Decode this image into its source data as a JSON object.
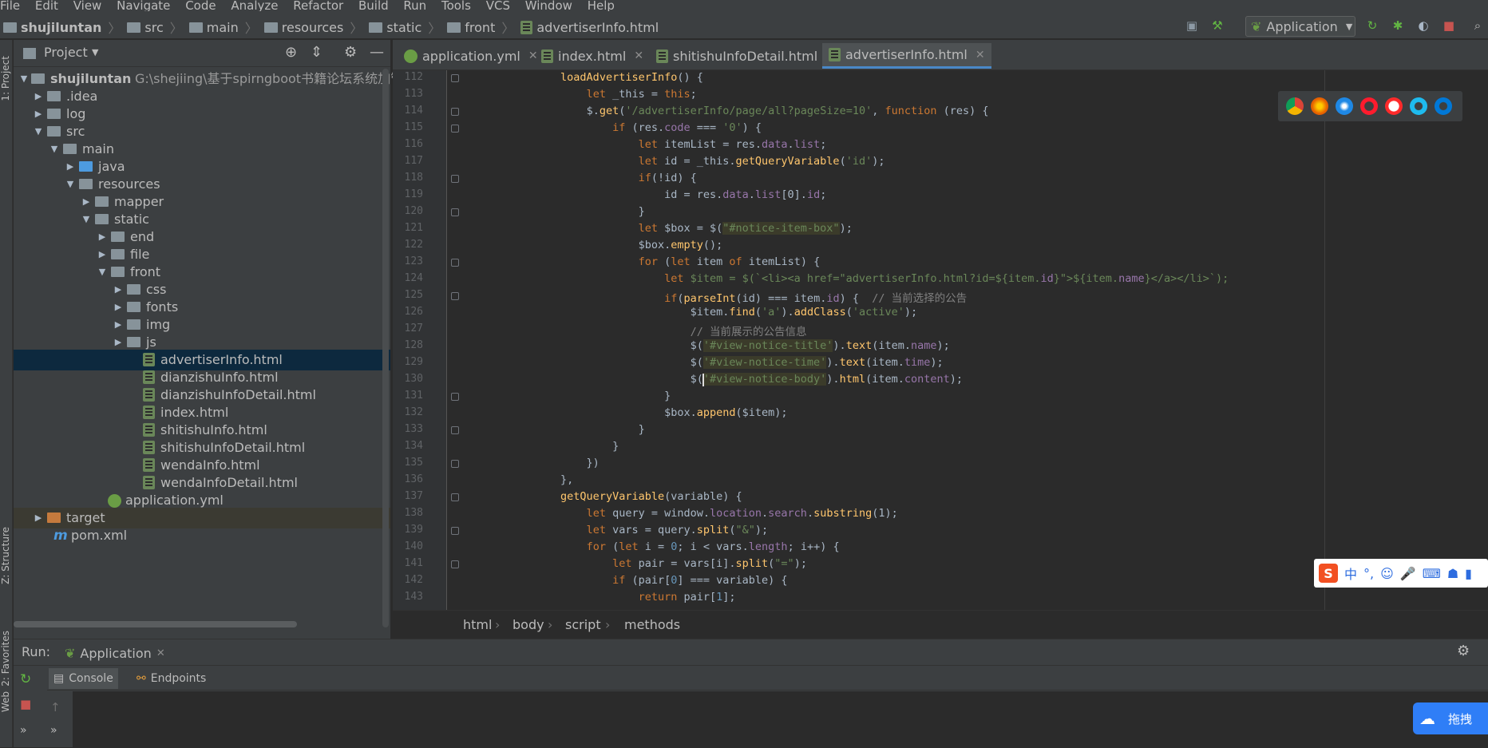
{
  "menu": [
    "File",
    "Edit",
    "View",
    "Navigate",
    "Code",
    "Analyze",
    "Refactor",
    "Build",
    "Run",
    "Tools",
    "VCS",
    "Window",
    "Help"
  ],
  "breadcrumb": [
    "shujiluntan",
    "src",
    "main",
    "resources",
    "static",
    "front",
    "advertiserInfo.html"
  ],
  "toolbar": {
    "run_config": "Application"
  },
  "side_tools": {
    "project": "1: Project",
    "structure": "Z: Structure",
    "favorites": "2: Favorites",
    "web": "Web"
  },
  "project": {
    "header": "Project",
    "root_name": "shujiluntan",
    "root_path": "G:\\shejiing\\基于spirngboot书籍论坛系统加管理",
    "items": [
      {
        "label": ".idea"
      },
      {
        "label": "log"
      },
      {
        "label": "src"
      },
      {
        "label": "main"
      },
      {
        "label": "java"
      },
      {
        "label": "resources"
      },
      {
        "label": "mapper"
      },
      {
        "label": "static"
      },
      {
        "label": "end"
      },
      {
        "label": "file"
      },
      {
        "label": "front"
      },
      {
        "label": "css"
      },
      {
        "label": "fonts"
      },
      {
        "label": "img"
      },
      {
        "label": "js"
      },
      {
        "label": "advertiserInfo.html"
      },
      {
        "label": "dianzishuInfo.html"
      },
      {
        "label": "dianzishuInfoDetail.html"
      },
      {
        "label": "index.html"
      },
      {
        "label": "shitishuInfo.html"
      },
      {
        "label": "shitishuInfoDetail.html"
      },
      {
        "label": "wendaInfo.html"
      },
      {
        "label": "wendaInfoDetail.html"
      },
      {
        "label": "application.yml"
      },
      {
        "label": "target"
      },
      {
        "label": "pom.xml"
      }
    ]
  },
  "tabs": [
    {
      "label": "application.yml"
    },
    {
      "label": "index.html"
    },
    {
      "label": "shitishuInfoDetail.html"
    },
    {
      "label": "advertiserInfo.html"
    }
  ],
  "line_numbers": [
    "112",
    "113",
    "114",
    "115",
    "116",
    "117",
    "118",
    "119",
    "120",
    "121",
    "122",
    "123",
    "124",
    "125",
    "126",
    "127",
    "128",
    "129",
    "130",
    "131",
    "132",
    "133",
    "134",
    "135",
    "136",
    "137",
    "138",
    "139",
    "140",
    "141",
    "142",
    "143"
  ],
  "code": {
    "l112": "loadAdvertiserInfo",
    "l113a": "let",
    "l113b": " _this = ",
    "l113c": "this",
    "l114a": "$.",
    "l114b": "get",
    "l114c": "'/advertiserInfo/page/all?pageSize=10'",
    "l114d": "function",
    "l114e": " (res) {",
    "l115a": "if",
    "l115b": " (res.",
    "l115c": "code",
    "l115d": " === ",
    "l115e": "'0'",
    "l116a": "let",
    "l116b": " itemList = res.",
    "l116c": "data",
    "l116d": "list",
    "l117a": "let",
    "l117b": " id = _this.",
    "l117c": "getQueryVariable",
    "l117d": "'id'",
    "l118a": "if",
    "l118b": "(!id) {",
    "l119a": "id = res.",
    "l119b": "data",
    "l119c": "list",
    "l119d": "[0].",
    "l119e": "id",
    "l121a": "let",
    "l121b": " $box = $(",
    "l121c": "\"#notice-item-box\"",
    "l122a": "$box.",
    "l122b": "empty",
    "l123a": "for",
    "l123b": " (",
    "l123c": "let",
    "l123d": " item ",
    "l123e": "of",
    "l123f": " itemList) {",
    "l124a": "let",
    "l124b": " $item = $(`<li><a href=\"advertiserInfo.html?id=${item.",
    "l124c": "id",
    "l124d": "}\">${item.",
    "l124e": "name",
    "l124f": "}</a></li>`);",
    "l125a": "if",
    "l125b": "(",
    "l125c": "parseInt",
    "l125d": "(id) === item.",
    "l125e": "id",
    "l125f": ") {  ",
    "l125g": "// 当前选择的公告",
    "l126a": "$item.",
    "l126b": "find",
    "l126c": "'a'",
    "l126d": "addClass",
    "l126e": "'active'",
    "l127": "// 当前展示的公告信息",
    "l128a": "'#view-notice-title'",
    "l128b": "text",
    "l128c": "name",
    "l129a": "'#view-notice-time'",
    "l129b": "text",
    "l129c": "time",
    "l130a": "'#view-notice-body'",
    "l130b": "html",
    "l130c": "content",
    "l132a": "$box.",
    "l132b": "append",
    "l132c": "($item);",
    "l137": "getQueryVariable",
    "l137b": "(variable) {",
    "l138a": "let",
    "l138b": " query = window.",
    "l138c": "location",
    "l138d": "search",
    "l138e": "substring",
    "l138f": "(1);",
    "l139a": "let",
    "l139b": " vars = query.",
    "l139c": "split",
    "l139d": "\"&\"",
    "l140a": "for",
    "l140b": " (",
    "l140c": "let",
    "l140d": " i = ",
    "l140e": "0",
    "l140f": "; i < vars.",
    "l140g": "length",
    "l140h": "; i++) {",
    "l141a": "let",
    "l141b": " pair = vars[i].",
    "l141c": "split",
    "l141d": "\"=\"",
    "l142a": "if",
    "l142b": " (pair[",
    "l142c": "0",
    "l142d": "] === variable) {",
    "l143a": "return",
    "l143b": " pair[",
    "l143c": "1",
    "l143d": "];"
  },
  "editor_breadcrumb": [
    "html",
    "body",
    "script",
    "methods"
  ],
  "run": {
    "label": "Run:",
    "tab": "Application",
    "console": "Console",
    "endpoints": "Endpoints"
  },
  "ime": {
    "zh": "中",
    "punct": "°,"
  },
  "baidu": {
    "label": "拖拽"
  },
  "colors": {
    "background": "#2b2b2b",
    "panel": "#3c3f41",
    "keyword": "#cc7832",
    "string": "#6a8759",
    "function": "#ffc66d",
    "property": "#9876aa",
    "selection": "#0d293e"
  }
}
